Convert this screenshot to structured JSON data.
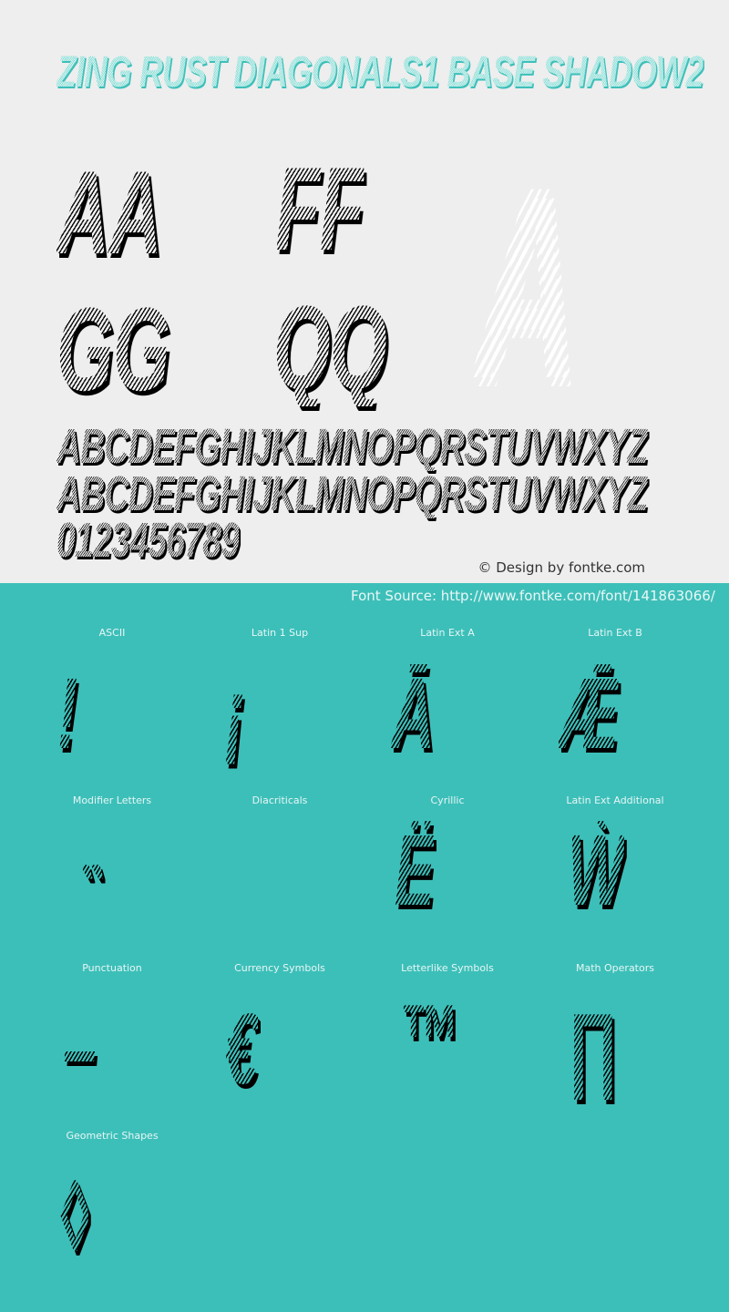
{
  "header": {
    "font_title": "ZING RUST DIAGONALS1 BASE SHADOW2"
  },
  "preview": {
    "pairs": [
      {
        "text": "AA"
      },
      {
        "text": "FF"
      },
      {
        "text": "GG"
      },
      {
        "text": "QQ"
      }
    ],
    "big_glyph": "A",
    "uppercase_line": "ABCDEFGHIJKLMNOPQRSTUVWXYZ",
    "lowercase_line": "abcdefghijklmnopqrstuvwxyz",
    "digits_line": "0123456789",
    "credit": "© Design by fontke.com"
  },
  "source": {
    "text": "Font Source: http://www.fontke.com/font/141863066/"
  },
  "colors": {
    "top_background": "#eeeeee",
    "bottom_background": "#3dbfb9",
    "title_accent": "#3dbfb9"
  },
  "charsets": [
    {
      "label": "ASCII",
      "glyph": "!"
    },
    {
      "label": "Latin 1 Sup",
      "glyph": "¡"
    },
    {
      "label": "Latin Ext A",
      "glyph": "Ā"
    },
    {
      "label": "Latin Ext B",
      "glyph": "Ǣ"
    },
    {
      "label": "Modifier Letters",
      "glyph": "˵"
    },
    {
      "label": "Diacriticals",
      "glyph": "̀"
    },
    {
      "label": "Cyrillic",
      "glyph": "Ё"
    },
    {
      "label": "Latin Ext Additional",
      "glyph": "Ẁ"
    },
    {
      "label": "Punctuation",
      "glyph": "–"
    },
    {
      "label": "Currency Symbols",
      "glyph": "€"
    },
    {
      "label": "Letterlike Symbols",
      "glyph": "™"
    },
    {
      "label": "Math Operators",
      "glyph": "∏"
    },
    {
      "label": "Geometric Shapes",
      "glyph": "◊"
    }
  ]
}
